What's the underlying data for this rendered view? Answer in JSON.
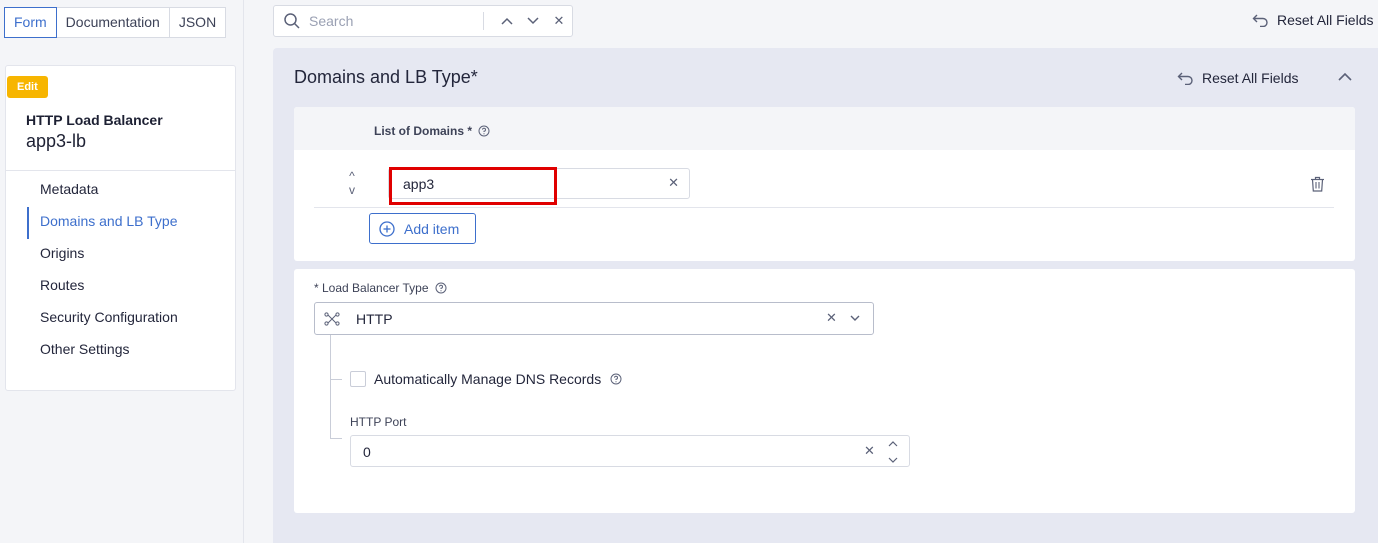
{
  "view_tabs": [
    "Form",
    "Documentation",
    "JSON"
  ],
  "search": {
    "placeholder": "Search",
    "up": "∧",
    "down": "∨",
    "clear": "✕"
  },
  "reset_all_fields": "Reset All Fields",
  "sidebar": {
    "badge": "Edit",
    "object_type": "HTTP Load Balancer",
    "object_name": "app3-lb",
    "items": [
      {
        "label": "Metadata",
        "active": false
      },
      {
        "label": "Domains and LB Type",
        "active": true
      },
      {
        "label": "Origins",
        "active": false
      },
      {
        "label": "Routes",
        "active": false
      },
      {
        "label": "Security Configuration",
        "active": false
      },
      {
        "label": "Other Settings",
        "active": false
      }
    ]
  },
  "section": {
    "title": "Domains and LB Type*",
    "reset_label": "Reset All Fields",
    "domains": {
      "label": "List of Domains *",
      "items": [
        {
          "value": "app3"
        }
      ],
      "add_item_label": "Add item"
    },
    "lb_type": {
      "label": "* Load Balancer Type",
      "value": "HTTP",
      "dns_label": "Automatically Manage DNS Records",
      "dns_checked": false,
      "port_label": "HTTP Port",
      "port_value": "0"
    }
  },
  "icons": {
    "search": "search-icon",
    "reset": "undo-arrow-icon",
    "collapse": "chevron-up-icon",
    "help": "question-circle-icon",
    "trash": "trash-icon",
    "plus": "plus-circle-icon",
    "lb": "load-balancer-icon"
  },
  "colors": {
    "accent": "#3d6fcc",
    "badge": "#f7b500",
    "highlight": "#e00000"
  }
}
